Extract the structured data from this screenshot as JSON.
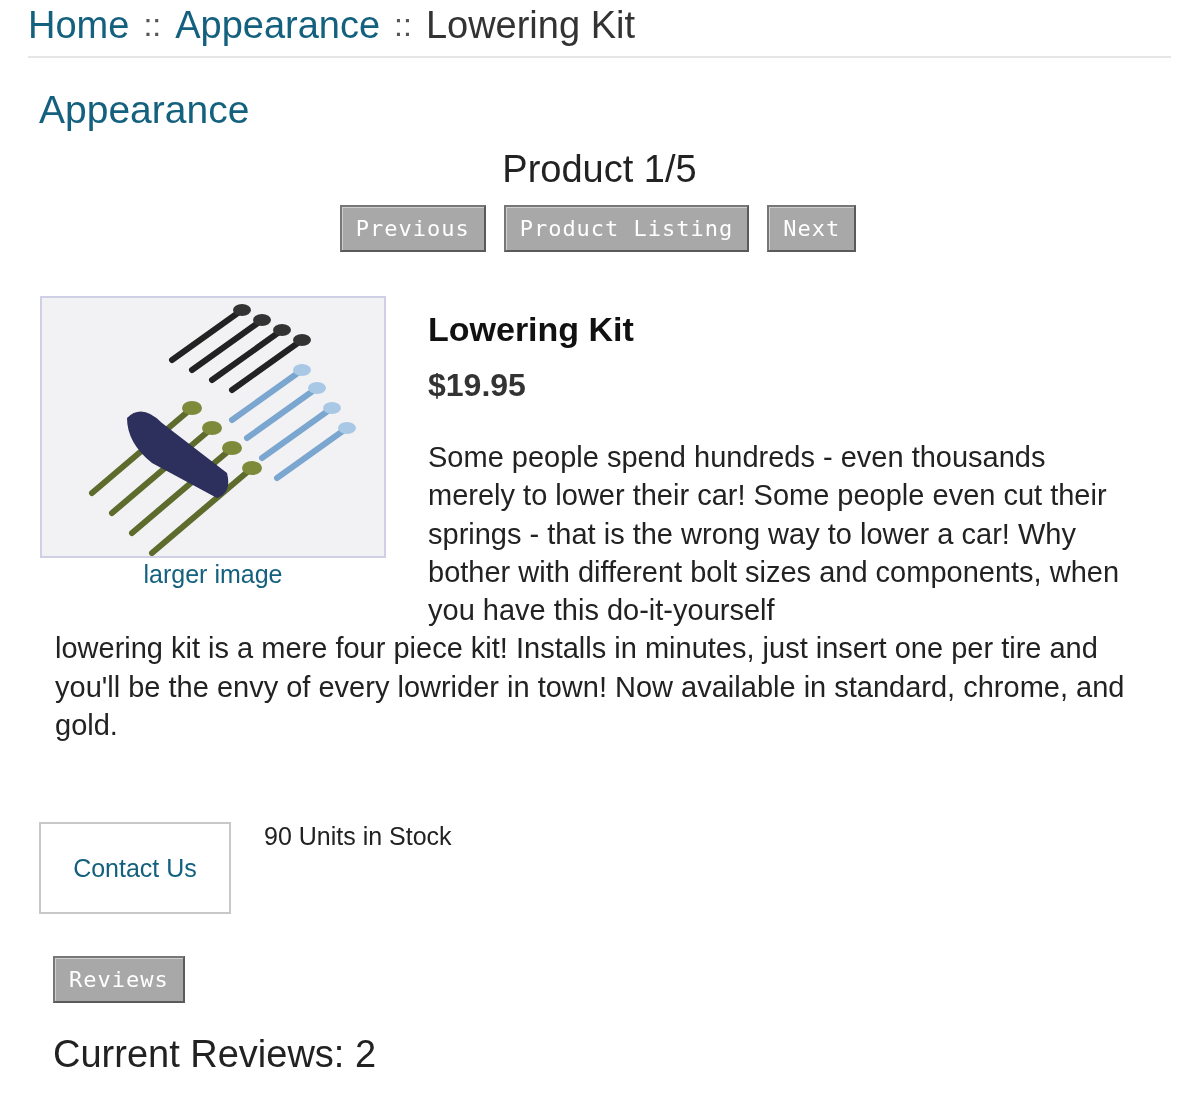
{
  "breadcrumb": [
    {
      "label": "Home",
      "kind": "link",
      "separator": "::"
    },
    {
      "label": "Appearance",
      "kind": "link",
      "separator": "::"
    },
    {
      "label": "Lowering Kit",
      "kind": "current"
    }
  ],
  "category_heading": "Appearance",
  "pager": {
    "label": "Product 1/5",
    "buttons": [
      "Previous",
      "Product Listing",
      "Next"
    ]
  },
  "product": {
    "image": {
      "kind": "picture",
      "link": "larger image"
    },
    "name": "Lowering Kit",
    "price": "$19.95",
    "description": [
      "Some people spend hundreds - even thousands merely to lower their car! Some people even cut their springs - that is the wrong way to lower a car! Why bother with different bolt sizes and components, when you have this do-it-yourself",
      "lowering kit is a mere four piece kit! Installs in minutes, just insert one per tire and you'll be the envy of every lowrider in town! Now available in standard, chrome, and gold."
    ],
    "stock": "90 Units in Stock"
  },
  "contact_button": "Contact Us",
  "reviews_button": "Reviews",
  "reviews_count": "Current Reviews: 2"
}
